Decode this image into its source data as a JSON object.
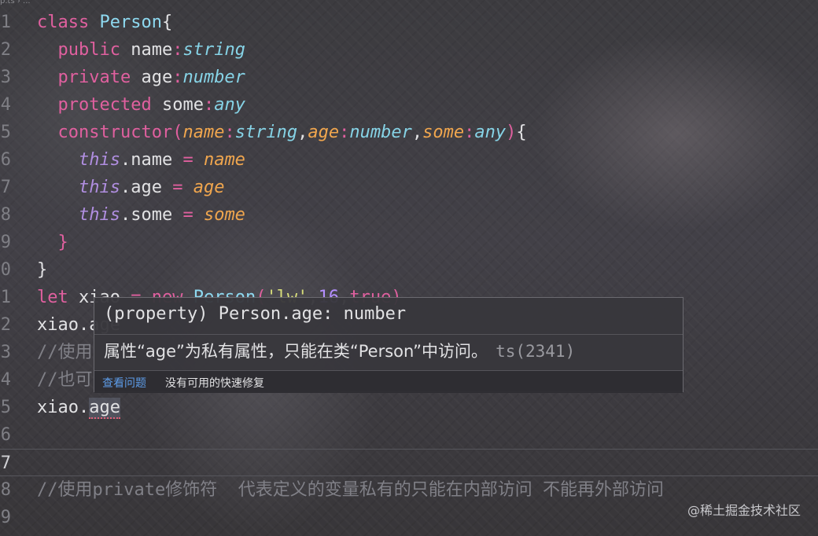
{
  "breadcrumb": "p.ts › ...",
  "lines": [
    {
      "n": "1",
      "tokens": [
        [
          "kw",
          "class"
        ],
        [
          "",
          ""
        ],
        [
          "cls",
          " Person"
        ],
        [
          "",
          "{"
        ]
      ]
    },
    {
      "n": "2",
      "tokens": [
        [
          "",
          "  "
        ],
        [
          "kw",
          "public"
        ],
        [
          "",
          " name"
        ],
        [
          "op",
          ":"
        ],
        [
          "typ",
          "string"
        ]
      ]
    },
    {
      "n": "3",
      "tokens": [
        [
          "",
          "  "
        ],
        [
          "kw",
          "private"
        ],
        [
          "",
          " age"
        ],
        [
          "op",
          ":"
        ],
        [
          "typ",
          "number"
        ]
      ]
    },
    {
      "n": "4",
      "tokens": [
        [
          "",
          "  "
        ],
        [
          "kw",
          "protected"
        ],
        [
          "",
          " some"
        ],
        [
          "op",
          ":"
        ],
        [
          "typ",
          "any"
        ]
      ]
    },
    {
      "n": "5",
      "tokens": [
        [
          "",
          "  "
        ],
        [
          "kw",
          "constructor"
        ],
        [
          "brk",
          "("
        ],
        [
          "prm",
          "name"
        ],
        [
          "op",
          ":"
        ],
        [
          "typ",
          "string"
        ],
        [
          "",
          ","
        ],
        [
          "prm",
          "age"
        ],
        [
          "op",
          ":"
        ],
        [
          "typ",
          "number"
        ],
        [
          "",
          ","
        ],
        [
          "prm",
          "some"
        ],
        [
          "op",
          ":"
        ],
        [
          "typ",
          "any"
        ],
        [
          "brk",
          ")"
        ],
        [
          "",
          "{"
        ]
      ]
    },
    {
      "n": "6",
      "tokens": [
        [
          "",
          "    "
        ],
        [
          "ths",
          "this"
        ],
        [
          "",
          ".name "
        ],
        [
          "op",
          "="
        ],
        [
          "prm",
          " name"
        ]
      ]
    },
    {
      "n": "7",
      "tokens": [
        [
          "",
          "    "
        ],
        [
          "ths",
          "this"
        ],
        [
          "",
          ".age "
        ],
        [
          "op",
          "="
        ],
        [
          "prm",
          " age"
        ]
      ]
    },
    {
      "n": "8",
      "tokens": [
        [
          "",
          "    "
        ],
        [
          "ths",
          "this"
        ],
        [
          "",
          ".some "
        ],
        [
          "op",
          "="
        ],
        [
          "prm",
          " some"
        ]
      ]
    },
    {
      "n": "9",
      "tokens": [
        [
          "",
          "  "
        ],
        [
          "brk",
          "}"
        ]
      ]
    },
    {
      "n": "0",
      "tokens": [
        [
          "",
          "}"
        ]
      ]
    },
    {
      "n": "1",
      "tokens": [
        [
          "kw",
          "let"
        ],
        [
          "",
          " xiao "
        ],
        [
          "op",
          "="
        ],
        [
          "kw",
          " new"
        ],
        [
          "cls",
          " Person"
        ],
        [
          "brk",
          "("
        ],
        [
          "str",
          "'lw'"
        ],
        [
          "",
          ","
        ],
        [
          "num",
          "16"
        ],
        [
          "",
          ","
        ],
        [
          "kw",
          "true"
        ],
        [
          "brk",
          ")"
        ]
      ]
    },
    {
      "n": "2",
      "tokens": [
        [
          "",
          "xiao.age"
        ]
      ]
    },
    {
      "n": "3",
      "tokens": [
        [
          "cmt",
          "//使用"
        ]
      ]
    },
    {
      "n": "4",
      "tokens": [
        [
          "cmt",
          "//也可"
        ]
      ]
    },
    {
      "n": "5",
      "tokens": [
        [
          "",
          "xiao."
        ],
        [
          "sel",
          "age"
        ]
      ]
    },
    {
      "n": "6",
      "tokens": []
    },
    {
      "n": "7",
      "tokens": []
    },
    {
      "n": "8",
      "tokens": [
        [
          "cmt",
          "//使用private修饰符  代表定义的变量私有的只能在内部访问 不能再外部访问"
        ]
      ]
    },
    {
      "n": "9",
      "tokens": []
    }
  ],
  "hover": {
    "signature": "(property) Person.age: number",
    "message": "属性“age”为私有属性，只能在类“Person”中访问。",
    "error_code": "ts(2341)",
    "view_problem": "查看问题",
    "no_fix": "没有可用的快速修复"
  },
  "watermark": "@稀土掘金技术社区",
  "colors": {
    "keyword": "#e0609f",
    "class": "#8ed9f0",
    "type": "#86d3e6",
    "param": "#f0a64e",
    "this": "#b08ee0",
    "comment": "#808087",
    "link": "#5d9ce8"
  }
}
